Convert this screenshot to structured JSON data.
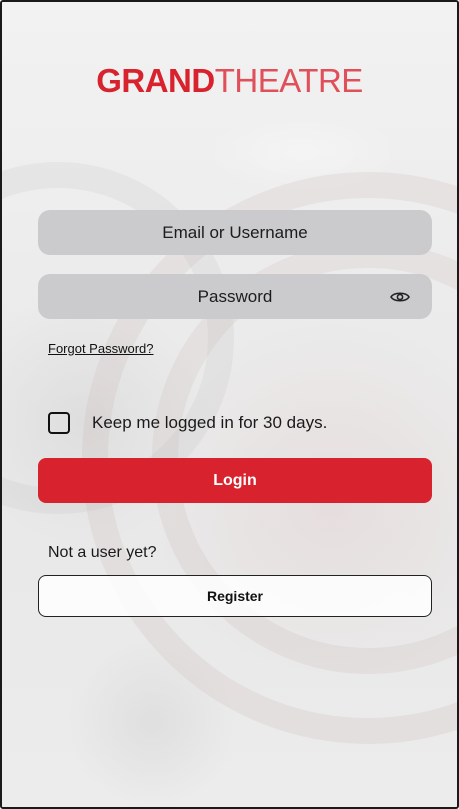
{
  "brand": {
    "strong": "GRAND",
    "light": "THEATRE"
  },
  "form": {
    "email_placeholder": "Email or Username",
    "password_placeholder": "Password",
    "forgot_password": "Forgot Password?",
    "keep_logged_in": "Keep me logged in for 30 days.",
    "keep_logged_in_checked": false,
    "login_label": "Login"
  },
  "register": {
    "prompt": "Not a user yet?",
    "button_label": "Register"
  },
  "colors": {
    "brand_red": "#d8232e",
    "field_bg": "#cbcbcd",
    "text": "#1a1a1a"
  },
  "icons": {
    "password_toggle": "eye-icon"
  }
}
